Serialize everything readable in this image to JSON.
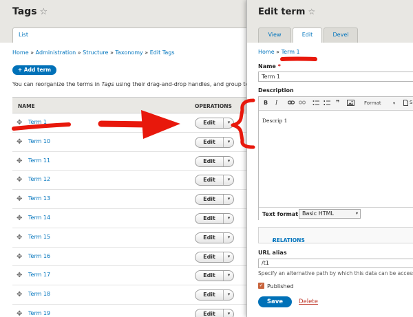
{
  "left": {
    "title": "Tags",
    "star": "☆",
    "list_tab": "List",
    "breadcrumb": [
      "Home",
      "Administration",
      "Structure",
      "Taxonomy",
      "Edit Tags"
    ],
    "breadcrumb_sep": "»",
    "add_button": "+ Add term",
    "intro_text_1": "You can reorganize the terms in ",
    "intro_text_italic": "Tags",
    "intro_text_2": " using their drag-and-drop handles, and group term",
    "table": {
      "col_name": "NAME",
      "col_operations": "OPERATIONS",
      "drag_icon": "✥",
      "edit_label": "Edit",
      "dropdown_arrow": "▾",
      "rows": [
        "Term 1",
        "Term 10",
        "Term 11",
        "Term 12",
        "Term 13",
        "Term 14",
        "Term 15",
        "Term 16",
        "Term 17",
        "Term 18",
        "Term 19"
      ]
    }
  },
  "panel": {
    "title": "Edit term",
    "star": "☆",
    "tabs": [
      {
        "label": "View",
        "active": false
      },
      {
        "label": "Edit",
        "active": true
      },
      {
        "label": "Devel",
        "active": false
      }
    ],
    "breadcrumb_home": "Home",
    "breadcrumb_sep": "»",
    "breadcrumb_term": "Term 1",
    "name_label": "Name",
    "name_required": "*",
    "name_value": "Term 1",
    "description_label": "Description",
    "toolbar": {
      "bold": "B",
      "italic": "I",
      "blockquote": "❞",
      "format": "Format",
      "source": "S"
    },
    "editor_content": "Descrip 1",
    "text_format_label": "Text format",
    "text_format_value": "Basic HTML",
    "relations_label": "RELATIONS",
    "relations_marker": "▸",
    "url_alias_label": "URL alias",
    "url_alias_value": "/t1",
    "url_alias_help": "Specify an alternative path by which this data can be accesse",
    "published_check": "✓",
    "published_label": "Published",
    "save_button": "Save",
    "delete_link": "Delete"
  },
  "annotation_color": "#e8180c"
}
